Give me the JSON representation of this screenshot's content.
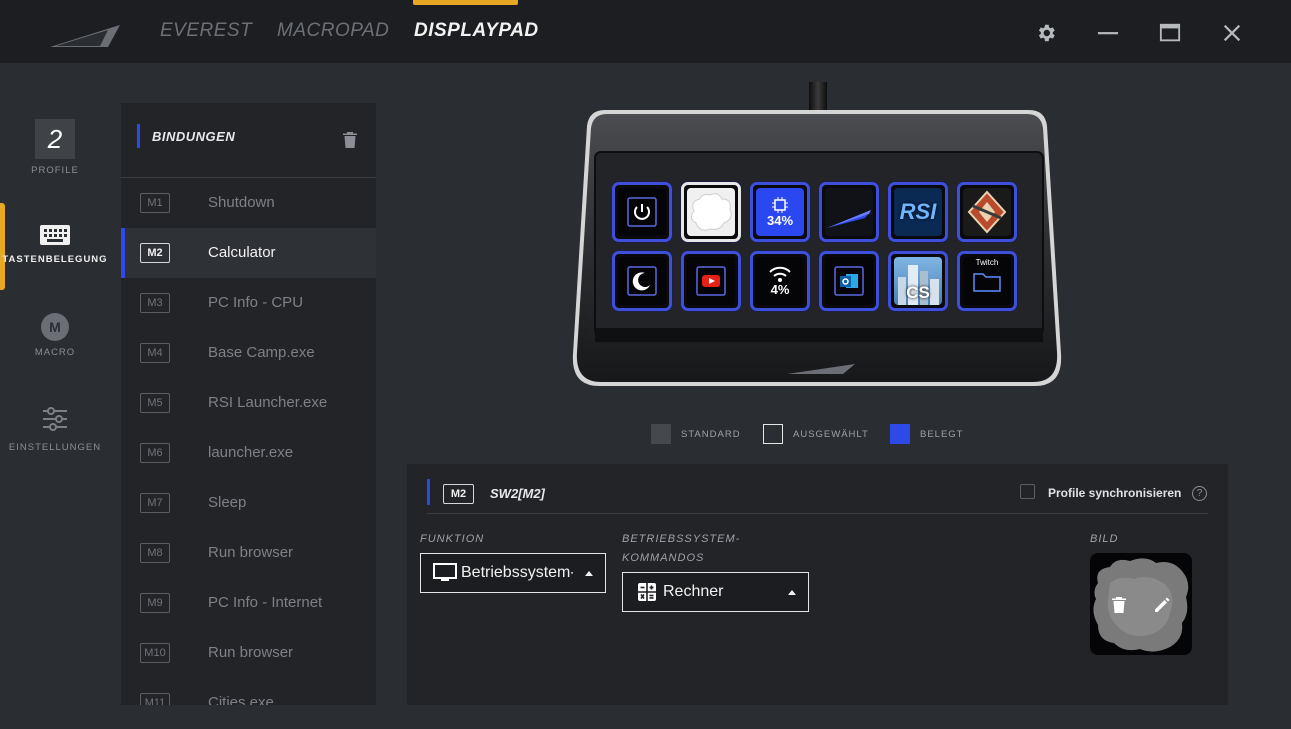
{
  "nav": {
    "tabs": [
      "EVEREST",
      "MACROPAD",
      "DISPLAYPAD"
    ],
    "active_tab": "DISPLAYPAD"
  },
  "rail": {
    "profile_number": "2",
    "profile_label": "PROFILE",
    "key_assignment_label": "TASTENBELEGUNG",
    "macro_glyph": "M",
    "macro_label": "MACRO",
    "settings_label": "EINSTELLUNGEN"
  },
  "bindings": {
    "title": "BINDUNGEN",
    "items": [
      {
        "key": "M1",
        "name": "Shutdown"
      },
      {
        "key": "M2",
        "name": "Calculator"
      },
      {
        "key": "M3",
        "name": "PC Info - CPU"
      },
      {
        "key": "M4",
        "name": "Base Camp.exe"
      },
      {
        "key": "M5",
        "name": "RSI Launcher.exe"
      },
      {
        "key": "M6",
        "name": "launcher.exe"
      },
      {
        "key": "M7",
        "name": "Sleep"
      },
      {
        "key": "M8",
        "name": "Run browser"
      },
      {
        "key": "M9",
        "name": "PC Info - Internet"
      },
      {
        "key": "M10",
        "name": "Run browser"
      },
      {
        "key": "M11",
        "name": "Cities.exe"
      }
    ]
  },
  "device": {
    "keys": {
      "cpu_value": "34%",
      "wifi_value": "4%",
      "rsi_text": "RSI",
      "cs_text": "CS",
      "twitch_text": "Twitch"
    }
  },
  "legend": {
    "standard": "STANDARD",
    "selected": "AUSGEWÄHLT",
    "assigned": "BELEGT"
  },
  "detail": {
    "badge": "M2",
    "title": "SW2[M2]",
    "sync_label": "Profile synchronisieren",
    "help_glyph": "?",
    "function_label": "FUNKTION",
    "function_value": "Betriebssystem-K",
    "os_label_1": "BETRIEBSSYSTEM-",
    "os_label_2": "KOMMANDOS",
    "os_value": "Rechner",
    "image_label": "BILD"
  },
  "colors": {
    "accent_gold": "#e8a823",
    "accent_blue": "#2e49e8",
    "panel": "#222428",
    "background": "#2a2d31"
  }
}
